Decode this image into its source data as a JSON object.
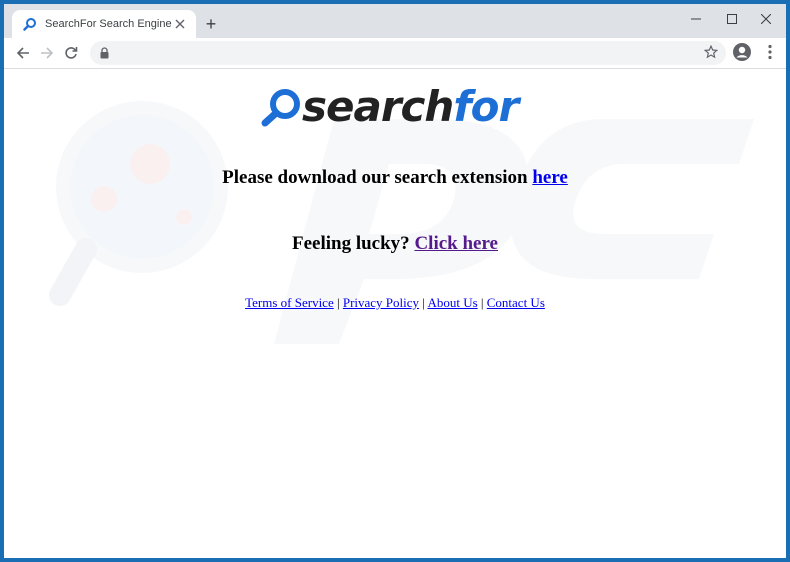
{
  "browser": {
    "tab_title": "SearchFor Search Engine",
    "new_tab_symbol": "+",
    "address": "",
    "icons": [
      "back-arrow-icon",
      "forward-arrow-icon",
      "reload-icon",
      "lock-icon",
      "star-icon",
      "profile-icon",
      "menu-icon",
      "minimize-icon",
      "maximize-icon",
      "close-icon"
    ]
  },
  "logo": {
    "part1": "search",
    "part2": "for",
    "accent_color": "#1d6fd6"
  },
  "main": {
    "download_text": "Please download our search extension ",
    "download_link": "here",
    "lucky_text": "Feeling lucky? ",
    "lucky_link": "Click here"
  },
  "footer": {
    "links": [
      "Terms of Service",
      "Privacy Policy",
      "About Us",
      "Contact Us"
    ],
    "separator": "|"
  }
}
